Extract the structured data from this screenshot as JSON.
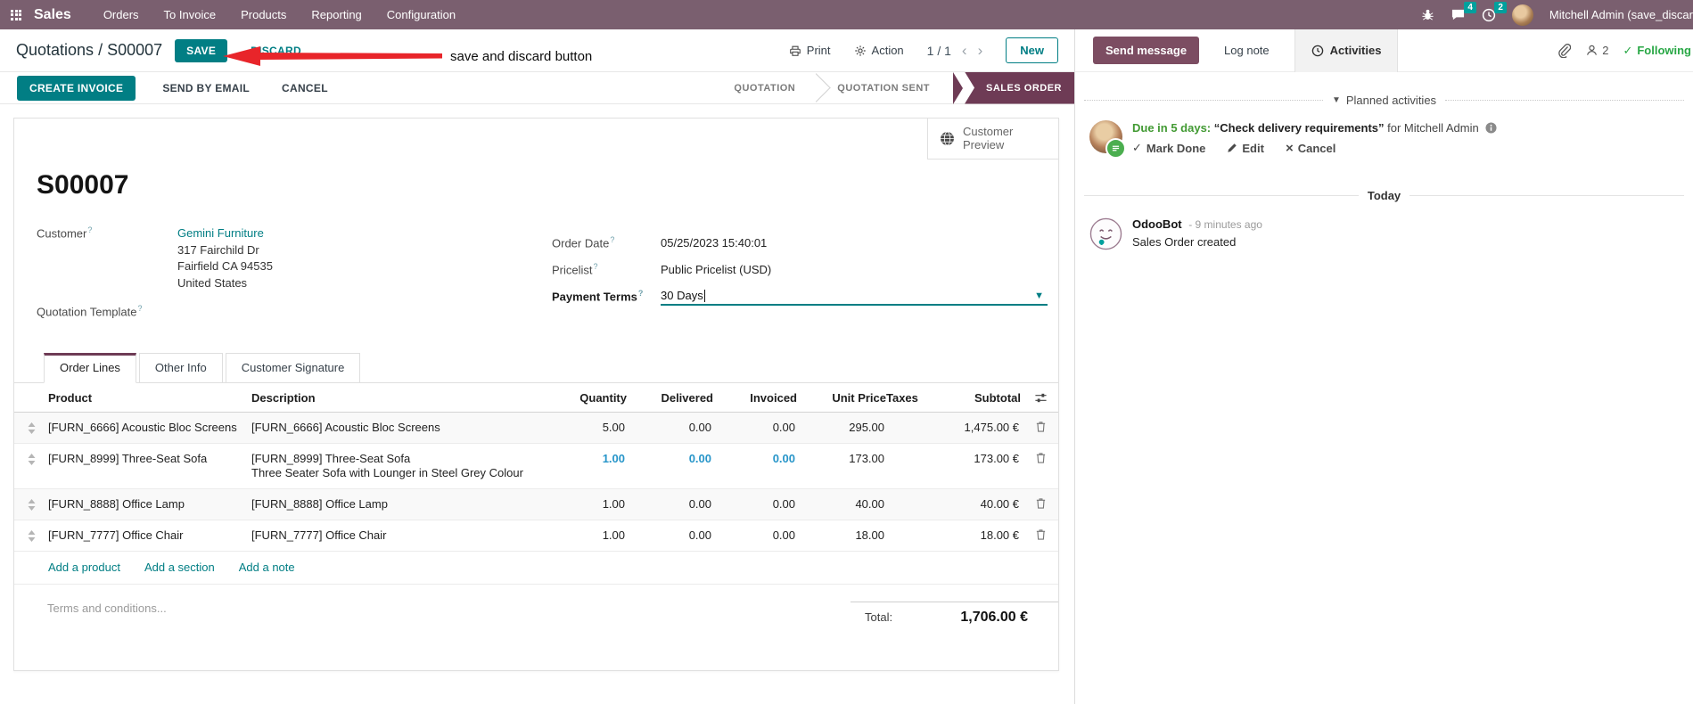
{
  "navbar": {
    "app": "Sales",
    "menus": [
      "Orders",
      "To Invoice",
      "Products",
      "Reporting",
      "Configuration"
    ],
    "messages_badge": "4",
    "activities_badge": "2",
    "user": "Mitchell Admin (save_discar"
  },
  "control_panel": {
    "breadcrumb_parent": "Quotations",
    "breadcrumb_sep": " / ",
    "record": "S00007",
    "save": "SAVE",
    "discard": "DISCARD",
    "annotation": "save and discard button",
    "print": "Print",
    "action": "Action",
    "pager": "1 / 1",
    "new": "New"
  },
  "statusbar": {
    "create_invoice": "CREATE INVOICE",
    "send_by_email": "SEND BY EMAIL",
    "cancel": "CANCEL",
    "stages": [
      {
        "label": "QUOTATION"
      },
      {
        "label": "QUOTATION SENT"
      },
      {
        "label": "SALES ORDER"
      }
    ]
  },
  "sheet": {
    "customer_preview": "Customer Preview",
    "title": "S00007",
    "customer": {
      "label": "Customer",
      "name": "Gemini Furniture",
      "address1": "317 Fairchild Dr",
      "address2": "Fairfield CA 94535",
      "address3": "United States"
    },
    "quotation_template_label": "Quotation Template",
    "order_date": {
      "label": "Order Date",
      "value": "05/25/2023 15:40:01"
    },
    "pricelist": {
      "label": "Pricelist",
      "value": "Public Pricelist (USD)"
    },
    "payment_terms": {
      "label": "Payment Terms",
      "value": "30 Days"
    },
    "tabs": [
      "Order Lines",
      "Other Info",
      "Customer Signature"
    ],
    "order_lines": {
      "columns": {
        "product": "Product",
        "description": "Description",
        "quantity": "Quantity",
        "delivered": "Delivered",
        "invoiced": "Invoiced",
        "unit_price": "Unit Price",
        "taxes": "Taxes",
        "subtotal": "Subtotal"
      },
      "rows": [
        {
          "product": "[FURN_6666] Acoustic Bloc Screens",
          "description": "[FURN_6666] Acoustic Bloc Screens",
          "description2": "",
          "quantity": "5.00",
          "delivered": "0.00",
          "invoiced": "0.00",
          "unit_price": "295.00",
          "taxes": "",
          "subtotal": "1,475.00 €"
        },
        {
          "product": "[FURN_8999] Three-Seat Sofa",
          "description": "[FURN_8999] Three-Seat Sofa",
          "description2": "Three Seater Sofa with Lounger in Steel Grey Colour",
          "quantity": "1.00",
          "delivered": "0.00",
          "invoiced": "0.00",
          "unit_price": "173.00",
          "taxes": "",
          "subtotal": "173.00 €"
        },
        {
          "product": "[FURN_8888] Office Lamp",
          "description": "[FURN_8888] Office Lamp",
          "description2": "",
          "quantity": "1.00",
          "delivered": "0.00",
          "invoiced": "0.00",
          "unit_price": "40.00",
          "taxes": "",
          "subtotal": "40.00 €"
        },
        {
          "product": "[FURN_7777] Office Chair",
          "description": "[FURN_7777] Office Chair",
          "description2": "",
          "quantity": "1.00",
          "delivered": "0.00",
          "invoiced": "0.00",
          "unit_price": "18.00",
          "taxes": "",
          "subtotal": "18.00 €"
        }
      ],
      "add_product": "Add a product",
      "add_section": "Add a section",
      "add_note": "Add a note"
    },
    "terms_placeholder": "Terms and conditions...",
    "total_label": "Total:",
    "total_value": "1,706.00 €"
  },
  "chatter": {
    "send_message": "Send message",
    "log_note": "Log note",
    "activities": "Activities",
    "followers_count": "2",
    "following": "Following",
    "planned_header": "Planned activities",
    "activity": {
      "due": "Due in 5 days:",
      "summary": "“Check delivery requirements”",
      "assignee": "for Mitchell Admin",
      "mark_done": "Mark Done",
      "edit": "Edit",
      "cancel": "Cancel"
    },
    "today": "Today",
    "message": {
      "author": "OdooBot",
      "time": "- 9 minutes ago",
      "body": "Sales Order created"
    }
  },
  "colors": {
    "navbar": "#7a5f6f",
    "primary_teal": "#017e84",
    "brand_purple": "#7c4d62",
    "stage_active": "#6e3b55",
    "badge_teal": "#00a09d",
    "edited_blue": "#2795c9",
    "arrow_red": "#e8252a",
    "activity_green": "#429a33",
    "following_green": "#28a745"
  }
}
